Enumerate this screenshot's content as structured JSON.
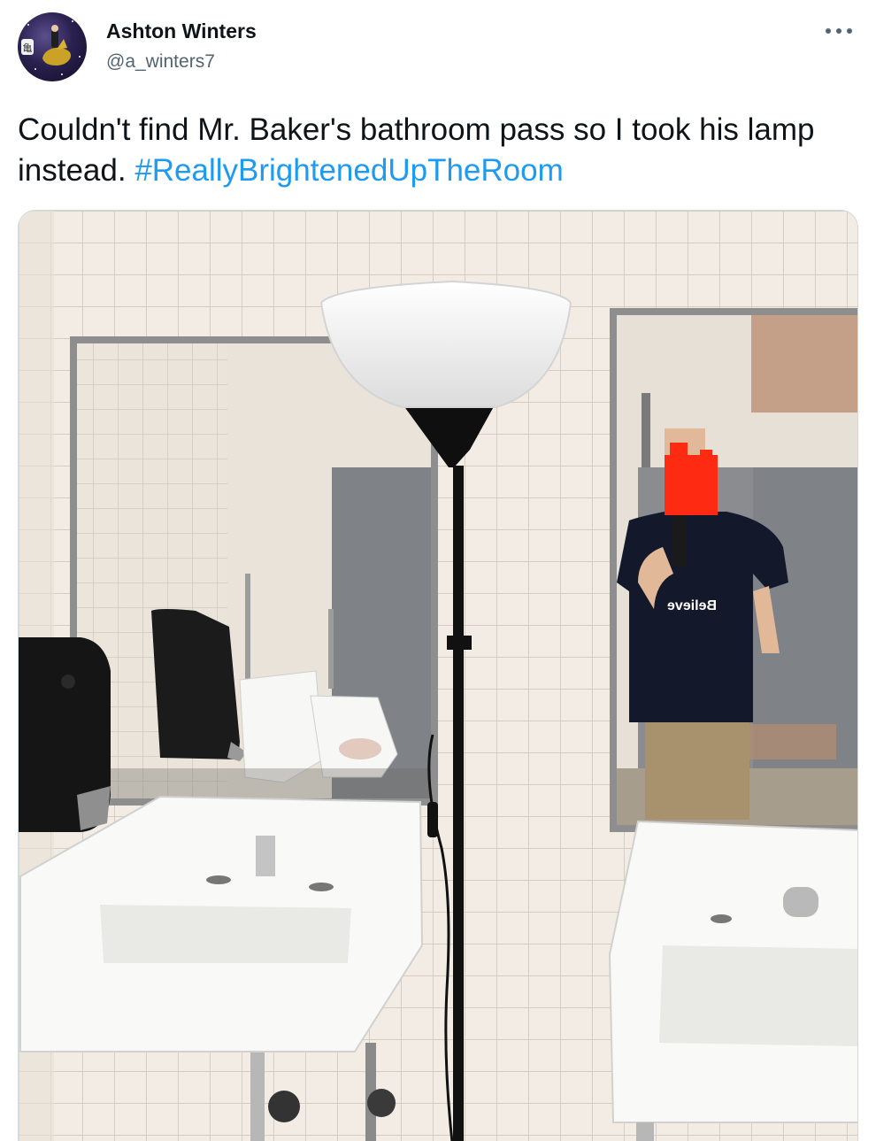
{
  "author": {
    "display_name": "Ashton Winters",
    "handle": "@a_winters7",
    "avatar_icon": "profile-avatar"
  },
  "tweet": {
    "text": "Couldn't find Mr. Baker's bathroom pass so I took his lamp instead. ",
    "hashtag": "#ReallyBrightenedUpTheRoom"
  },
  "more_icon": "more-horizontal-icon",
  "photo": {
    "shirt_text": "Believe",
    "description_icon": "photo"
  },
  "colors": {
    "hashtag": "#1d9bf0",
    "handle": "#536471",
    "censor": "#ff2a12"
  }
}
